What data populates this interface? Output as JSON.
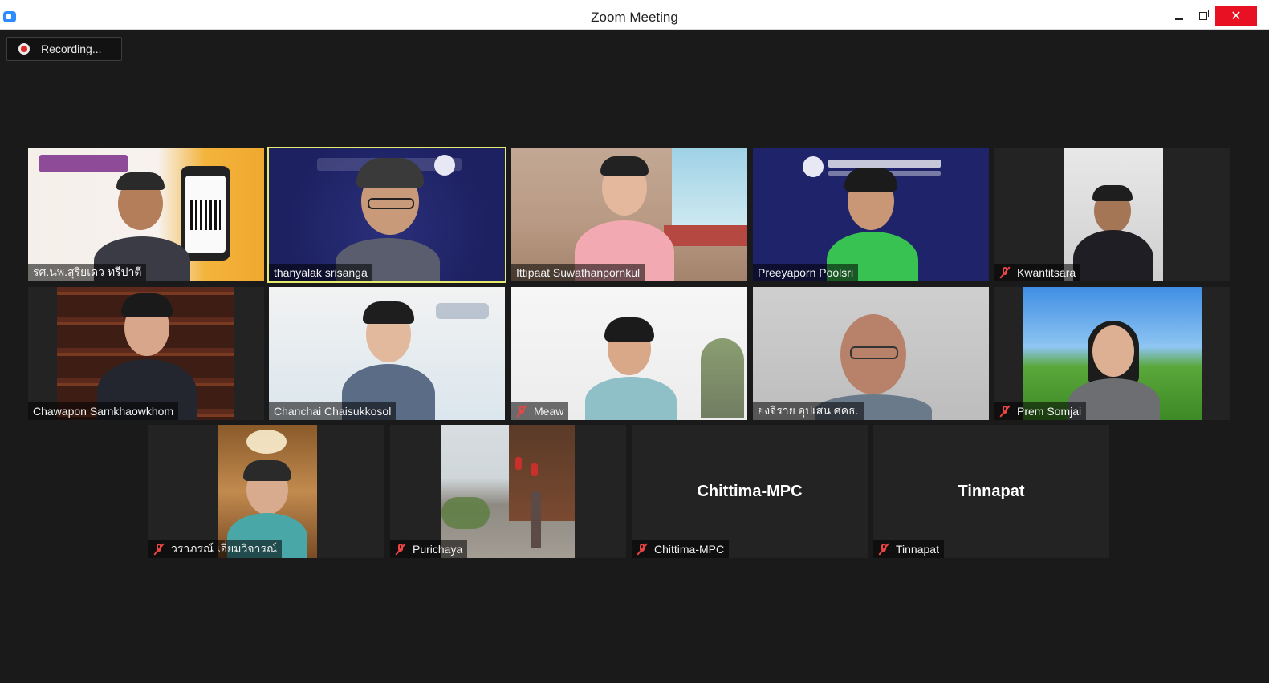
{
  "window": {
    "title": "Zoom Meeting",
    "close_glyph": "✕"
  },
  "recording": {
    "label": "Recording..."
  },
  "participants": [
    {
      "name": "รศ.นพ.สุริยเดว ทรีปาตี",
      "muted": false,
      "video": true
    },
    {
      "name": "thanyalak srisanga",
      "muted": false,
      "video": true,
      "active_speaker": true
    },
    {
      "name": "Ittipaat Suwathanpornkul",
      "muted": false,
      "video": true
    },
    {
      "name": "Preeyaporn Poolsri",
      "muted": false,
      "video": true
    },
    {
      "name": "Kwantitsara",
      "muted": true,
      "video": true
    },
    {
      "name": "Chawapon Sarnkhaowkhom",
      "muted": false,
      "video": true
    },
    {
      "name": "Chanchai Chaisukkosol",
      "muted": false,
      "video": true
    },
    {
      "name": "Meaw",
      "muted": true,
      "video": true
    },
    {
      "name": "ยงจิราย อุปเสน ศคธ.",
      "muted": false,
      "video": true
    },
    {
      "name": "Prem Somjai",
      "muted": true,
      "video": true
    },
    {
      "name": "วราภรณ์ เอี่ยมวิจารณ์",
      "muted": true,
      "video": true
    },
    {
      "name": "Purichaya",
      "muted": true,
      "video": true
    },
    {
      "name": "Chittima-MPC",
      "muted": true,
      "video": false
    },
    {
      "name": "Tinnapat",
      "muted": true,
      "video": false
    }
  ]
}
